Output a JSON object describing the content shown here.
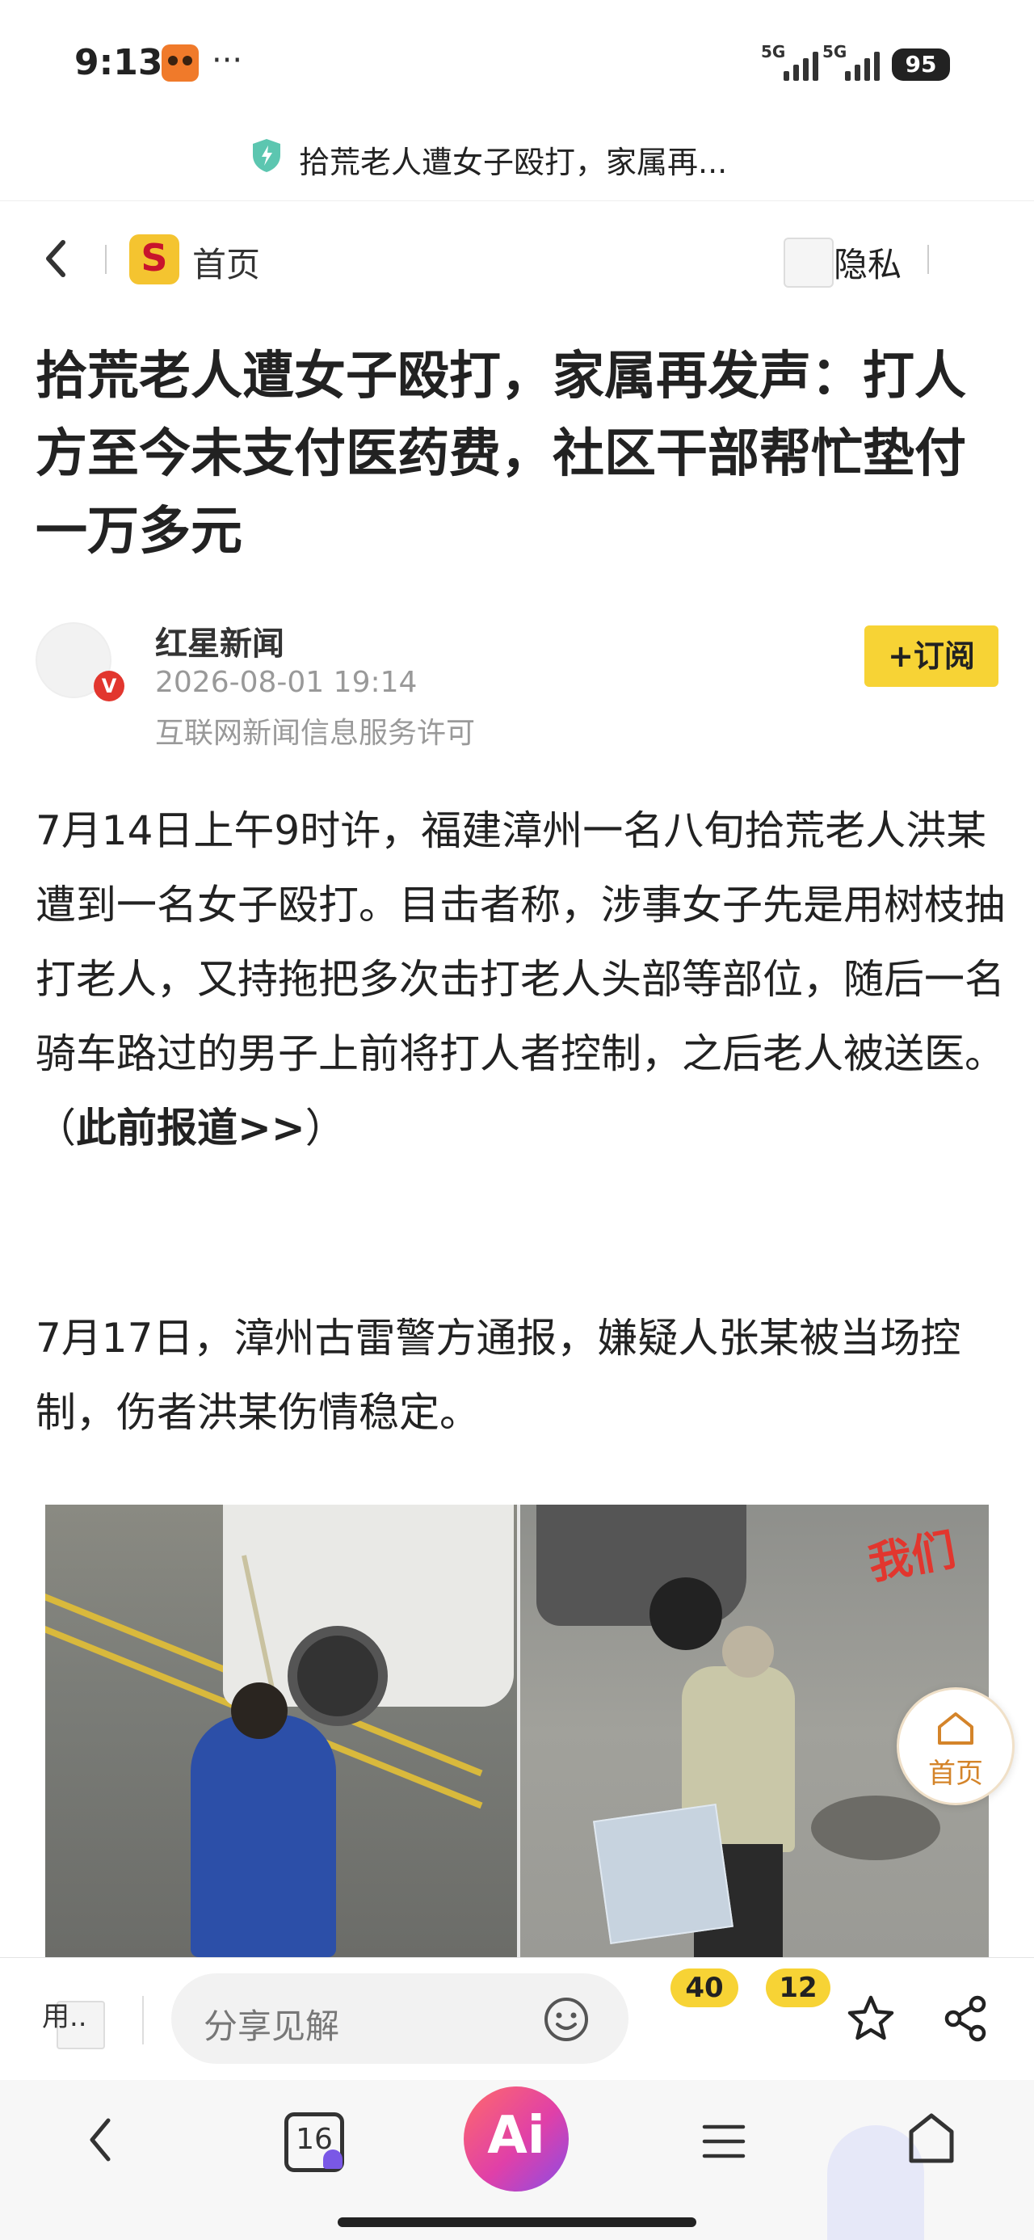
{
  "status_bar": {
    "time": "9:13",
    "dots": "···",
    "signal1_label": "5G",
    "signal2_label": "5G",
    "battery": "95"
  },
  "title_strip": {
    "text": "拾荒老人遭女子殴打，家属再..."
  },
  "nav": {
    "home_label": "首页",
    "privacy_label": "隐私",
    "logo_letter": "S"
  },
  "article": {
    "headline": "拾荒老人遭女子殴打，家属再发声：打人方至今未支付医药费，社区干部帮忙垫付一万多元",
    "author": {
      "name": "红星新闻",
      "date": "2026-08-01 19:14",
      "license": "互联网新闻信息服务许可",
      "badge": "V"
    },
    "subscribe_label": "+订阅",
    "para1_text": "7月14日上午9时许，福建漳州一名八旬拾荒老人洪某遭到一名女子殴打。目击者称，涉事女子先是用树枝抽打老人，又持拖把多次击打老人头部等部位，随后一名骑车路过的男子上前将打人者控制，之后老人被送医。（",
    "para1_link": "此前报道>>",
    "para1_end": "）",
    "para2_text": "7月17日，漳州古雷警方通报，嫌疑人张某被当场控制，伤者洪某伤情稳定。",
    "photo_watermark": "我们"
  },
  "float_home": {
    "label": "首页"
  },
  "comment_bar": {
    "user_label": "用..",
    "placeholder": "分享见解",
    "badge_comments": "40",
    "badge_likes": "12"
  },
  "bottom_nav": {
    "tabs_count": "16",
    "ai_label": "Ai"
  },
  "colors": {
    "accent_yellow": "#f7d335",
    "badge_red": "#e2362e",
    "float_home_orange": "#d4842a"
  }
}
